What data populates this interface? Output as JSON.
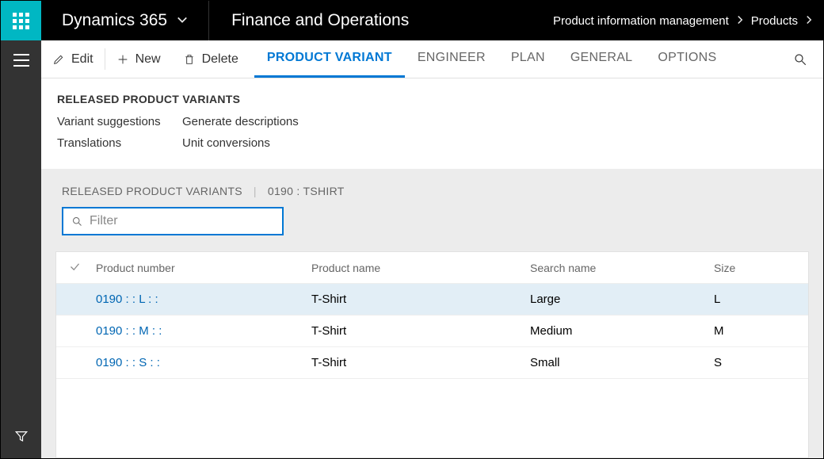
{
  "topbar": {
    "brand": "Dynamics 365",
    "module": "Finance and Operations",
    "breadcrumb": [
      "Product information management",
      "Products"
    ]
  },
  "actions": {
    "edit": "Edit",
    "new": "New",
    "delete": "Delete"
  },
  "tabs": [
    "PRODUCT VARIANT",
    "ENGINEER",
    "PLAN",
    "GENERAL",
    "OPTIONS"
  ],
  "tabs_active_index": 0,
  "group": {
    "title": "RELEASED PRODUCT VARIANTS",
    "links": {
      "c1r1": "Variant suggestions",
      "c1r2": "Translations",
      "c2r1": "Generate descriptions",
      "c2r2": "Unit conversions"
    }
  },
  "page_crumb": {
    "section": "RELEASED PRODUCT VARIANTS",
    "record": "0190 : TSHIRT"
  },
  "filter": {
    "placeholder": "Filter",
    "value": ""
  },
  "columns": {
    "product_number": "Product number",
    "product_name": "Product name",
    "search_name": "Search name",
    "size": "Size"
  },
  "rows": [
    {
      "product_number": "0190 :  : L :  :",
      "product_name": "T-Shirt",
      "search_name": "Large",
      "size": "L",
      "selected": true
    },
    {
      "product_number": "0190 :  : M :  :",
      "product_name": "T-Shirt",
      "search_name": "Medium",
      "size": "M",
      "selected": false
    },
    {
      "product_number": "0190 :  : S :  :",
      "product_name": "T-Shirt",
      "search_name": "Small",
      "size": "S",
      "selected": false
    }
  ]
}
